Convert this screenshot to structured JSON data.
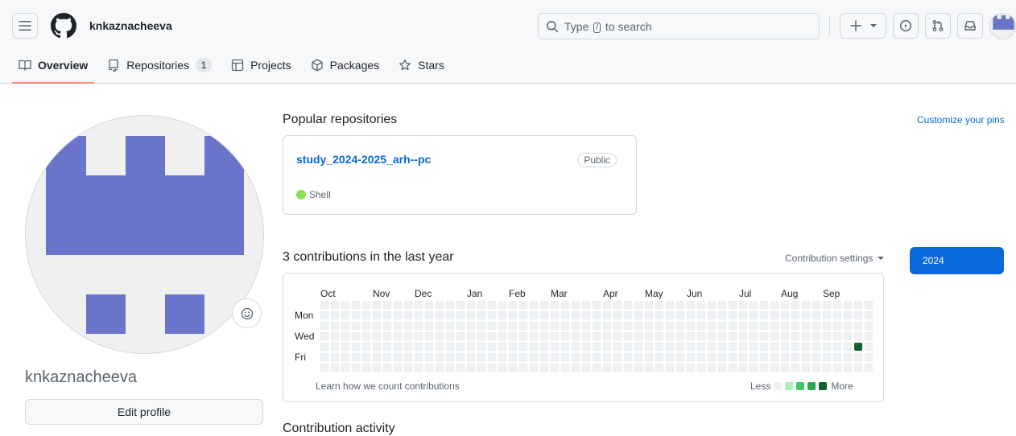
{
  "header": {
    "username": "knkaznacheeva",
    "search_before": "Type",
    "search_key": "/",
    "search_after": "to search"
  },
  "tabs": [
    {
      "label": "Overview",
      "icon": "book-icon",
      "active": true
    },
    {
      "label": "Repositories",
      "icon": "repo-icon",
      "count": "1"
    },
    {
      "label": "Projects",
      "icon": "table-icon"
    },
    {
      "label": "Packages",
      "icon": "package-icon"
    },
    {
      "label": "Stars",
      "icon": "star-icon"
    }
  ],
  "profile": {
    "name": "knkaznacheeva",
    "edit_label": "Edit profile",
    "avatar_color": "#6a74c9"
  },
  "popular": {
    "title": "Popular repositories",
    "customize_label": "Customize your pins",
    "repos": [
      {
        "name": "study_2024-2025_arh--pc",
        "visibility": "Public",
        "language": "Shell",
        "language_color": "#89e051"
      }
    ]
  },
  "contributions": {
    "title": "3 contributions in the last year",
    "settings_label": "Contribution settings",
    "year_label": "2024",
    "months": [
      "Oct",
      "Nov",
      "Dec",
      "Jan",
      "Feb",
      "Mar",
      "Apr",
      "May",
      "Jun",
      "Jul",
      "Aug",
      "Sep"
    ],
    "days": [
      "Mon",
      "Wed",
      "Fri"
    ],
    "learn_label": "Learn how we count contributions",
    "less_label": "Less",
    "more_label": "More",
    "level_colors": [
      "#eff2f5",
      "#aceebb",
      "#4ac26b",
      "#2da44e",
      "#116329"
    ],
    "active_cells": [
      {
        "week": 51,
        "day": 4,
        "level": 4
      }
    ]
  },
  "next_section_title": "Contribution activity"
}
